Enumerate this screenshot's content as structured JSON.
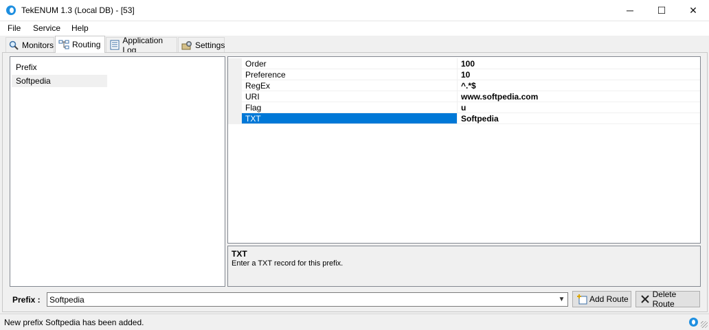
{
  "window": {
    "title": "TekENUM 1.3 (Local DB) - [53]",
    "minimize": "─",
    "maximize": "☐",
    "close": "✕"
  },
  "menu": [
    "File",
    "Service",
    "Help"
  ],
  "tabs": [
    {
      "label": "Monitors",
      "icon": "magnifier-icon"
    },
    {
      "label": "Routing",
      "icon": "routing-icon",
      "active": true
    },
    {
      "label": "Application Log",
      "icon": "log-icon"
    },
    {
      "label": "Settings",
      "icon": "settings-icon"
    }
  ],
  "prefix_list": {
    "header": "Prefix",
    "items": [
      "Softpedia"
    ]
  },
  "properties": [
    {
      "name": "Order",
      "value": "100"
    },
    {
      "name": "Preference",
      "value": "10"
    },
    {
      "name": "RegEx",
      "value": "^.*$"
    },
    {
      "name": "URI",
      "value": "www.softpedia.com"
    },
    {
      "name": "Flag",
      "value": "u"
    },
    {
      "name": "TXT",
      "value": "Softpedia",
      "selected": true
    }
  ],
  "help": {
    "title": "TXT",
    "description": "Enter a TXT record for this prefix."
  },
  "bottom": {
    "prefix_label": "Prefix :",
    "prefix_value": "Softpedia",
    "add_route": "Add Route",
    "delete_route": "Delete Route"
  },
  "status": {
    "text": "New prefix Softpedia has been added."
  },
  "colors": {
    "selection": "#0078d7",
    "accent": "#1e8fe0"
  }
}
